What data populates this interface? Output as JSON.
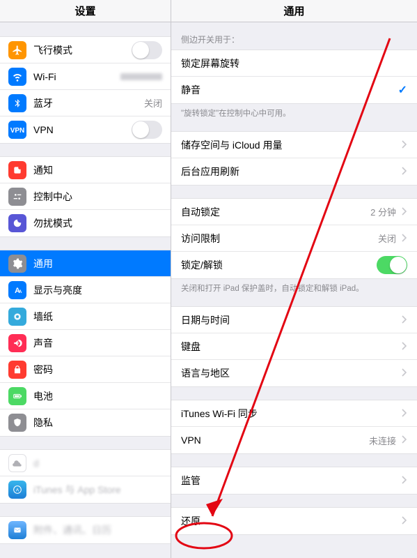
{
  "left": {
    "title": "设置",
    "rows": {
      "airplane": "飞行模式",
      "wifi": "Wi-Fi",
      "bluetooth": "蓝牙",
      "bluetooth_value": "关闭",
      "vpn": "VPN",
      "notifications": "通知",
      "control_center": "控制中心",
      "dnd": "勿扰模式",
      "general": "通用",
      "display": "显示与亮度",
      "wallpaper": "墙纸",
      "sounds": "声音",
      "passcode": "密码",
      "battery": "电池",
      "privacy": "隐私",
      "blur1": "d",
      "blur2": "iTunes 与 App Store",
      "blur3": "附件、通讯、日历"
    }
  },
  "right": {
    "title": "通用",
    "side_switch_label": "侧边开关用于：",
    "rotation_lock": "锁定屏幕旋转",
    "mute": "静音",
    "rotation_note": "\"旋转锁定\"在控制中心中可用。",
    "storage": "储存空间与 iCloud 用量",
    "background_refresh": "后台应用刷新",
    "auto_lock": "自动锁定",
    "auto_lock_value": "2 分钟",
    "restrictions": "访问限制",
    "restrictions_value": "关闭",
    "lock_unlock": "锁定/解锁",
    "cover_note": "关闭和打开 iPad 保护盖时，自动锁定和解锁 iPad。",
    "date_time": "日期与时间",
    "keyboard": "键盘",
    "language_region": "语言与地区",
    "itunes_sync": "iTunes Wi-Fi 同步",
    "vpn": "VPN",
    "vpn_value": "未连接",
    "profiles": "监管",
    "reset": "还原"
  }
}
